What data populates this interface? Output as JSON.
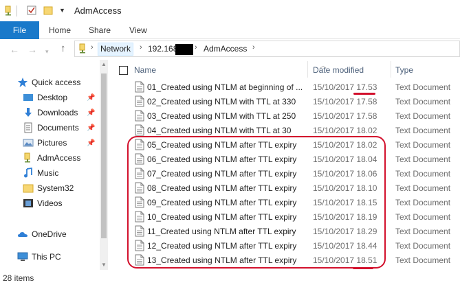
{
  "window": {
    "title": "AdmAccess"
  },
  "ribbon": {
    "tabs": [
      {
        "label": "File"
      },
      {
        "label": "Home"
      },
      {
        "label": "Share"
      },
      {
        "label": "View"
      }
    ]
  },
  "address": {
    "crumbs": [
      "Network",
      "192.168",
      "AdmAccess"
    ]
  },
  "nav": {
    "items": [
      {
        "label": "Quick access",
        "icon": "star-icon",
        "pinned": false
      },
      {
        "label": "Desktop",
        "icon": "desktop-icon",
        "pinned": true
      },
      {
        "label": "Downloads",
        "icon": "download-icon",
        "pinned": true
      },
      {
        "label": "Documents",
        "icon": "documents-icon",
        "pinned": true
      },
      {
        "label": "Pictures",
        "icon": "pictures-icon",
        "pinned": true
      },
      {
        "label": "AdmAccess",
        "icon": "network-folder-icon",
        "pinned": false
      },
      {
        "label": "Music",
        "icon": "music-icon",
        "pinned": false
      },
      {
        "label": "System32",
        "icon": "folder-icon",
        "pinned": false
      },
      {
        "label": "Videos",
        "icon": "videos-icon",
        "pinned": false
      },
      {
        "label": "OneDrive",
        "icon": "onedrive-icon",
        "pinned": false
      },
      {
        "label": "This PC",
        "icon": "this-pc-icon",
        "pinned": false
      }
    ]
  },
  "columns": {
    "name": "Name",
    "date": "Date modified",
    "type": "Type"
  },
  "files": [
    {
      "name": "01_Created using NTLM at beginning of ...",
      "date": "15/10/2017 17.53",
      "type": "Text Document"
    },
    {
      "name": "02_Created using NTLM with TTL at 330",
      "date": "15/10/2017 17.58",
      "type": "Text Document"
    },
    {
      "name": "03_Created using NTLM with TTL at 250",
      "date": "15/10/2017 17.58",
      "type": "Text Document"
    },
    {
      "name": "04_Created using NTLM with TTL at 30",
      "date": "15/10/2017 18.02",
      "type": "Text Document"
    },
    {
      "name": "05_Created using NTLM after TTL expiry",
      "date": "15/10/2017 18.02",
      "type": "Text Document"
    },
    {
      "name": "06_Created using NTLM after TTL expiry",
      "date": "15/10/2017 18.04",
      "type": "Text Document"
    },
    {
      "name": "07_Created using NTLM after TTL expiry",
      "date": "15/10/2017 18.06",
      "type": "Text Document"
    },
    {
      "name": "08_Created using NTLM after TTL expiry",
      "date": "15/10/2017 18.10",
      "type": "Text Document"
    },
    {
      "name": "09_Created using NTLM after TTL expiry",
      "date": "15/10/2017 18.15",
      "type": "Text Document"
    },
    {
      "name": "10_Created using NTLM after TTL expiry",
      "date": "15/10/2017 18.19",
      "type": "Text Document"
    },
    {
      "name": "11_Created using NTLM after TTL expiry",
      "date": "15/10/2017 18.29",
      "type": "Text Document"
    },
    {
      "name": "12_Created using NTLM after TTL expiry",
      "date": "15/10/2017 18.44",
      "type": "Text Document"
    },
    {
      "name": "13_Created using NTLM after TTL expiry",
      "date": "15/10/2017 18.51",
      "type": "Text Document"
    }
  ],
  "status": {
    "count": "28 items"
  },
  "colors": {
    "accent": "#1979ca",
    "annotation": "#d2102c"
  }
}
